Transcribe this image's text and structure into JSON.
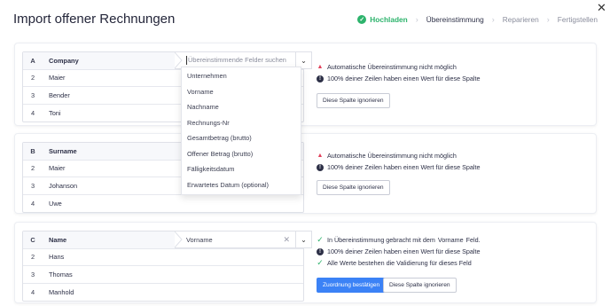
{
  "title": "Import offener Rechnungen",
  "stepper": {
    "steps": [
      "Hochladen",
      "Übereinstimmung",
      "Reparieren",
      "Fertigstellen"
    ]
  },
  "cards": [
    {
      "column_letter": "A",
      "column_name": "Company",
      "rows": [
        {
          "idx": "2",
          "value": "Maier"
        },
        {
          "idx": "3",
          "value": "Bender"
        },
        {
          "idx": "4",
          "value": "Toni"
        }
      ],
      "match_placeholder": "Übereinstimmende Felder suchen",
      "messages": [
        "Automatische Übereinstimmung nicht möglich",
        "100% deiner Zeilen haben einen Wert für diese Spalte"
      ],
      "ignore_label": "Diese Spalte ignorieren"
    },
    {
      "column_letter": "B",
      "column_name": "Surname",
      "rows": [
        {
          "idx": "2",
          "value": "Maier"
        },
        {
          "idx": "3",
          "value": "Johanson"
        },
        {
          "idx": "4",
          "value": "Uwe"
        }
      ],
      "messages": [
        "Automatische Übereinstimmung nicht möglich",
        "100% deiner Zeilen haben einen Wert für diese Spalte"
      ],
      "ignore_label": "Diese Spalte ignorieren"
    },
    {
      "column_letter": "C",
      "column_name": "Name",
      "rows": [
        {
          "idx": "2",
          "value": "Hans"
        },
        {
          "idx": "3",
          "value": "Thomas"
        },
        {
          "idx": "4",
          "value": "Manhold"
        }
      ],
      "match_value": "Vorname",
      "messages": {
        "matched_prefix": "In Übereinstimmung gebracht mit dem",
        "matched_field": "Vorname",
        "matched_suffix": "Feld.",
        "coverage": "100% deiner Zeilen haben einen Wert für diese Spalte",
        "validation": "Alle Werte bestehen die Validierung für dieses Feld"
      },
      "confirm_label": "Zuordnung bestätigen",
      "ignore_label": "Diese Spalte ignorieren"
    }
  ],
  "dropdown_options": [
    "Unternehmen",
    "Vorname",
    "Nachname",
    "Rechnungs-Nr",
    "Gesamtbetrag (brutto)",
    "Offener Betrag (brutto)",
    "Fälligkeitsdatum",
    "Erwartetes Datum (optional)"
  ],
  "colors": {
    "success": "#2db36c",
    "warning": "#e0405a",
    "primary": "#3b82f6"
  }
}
